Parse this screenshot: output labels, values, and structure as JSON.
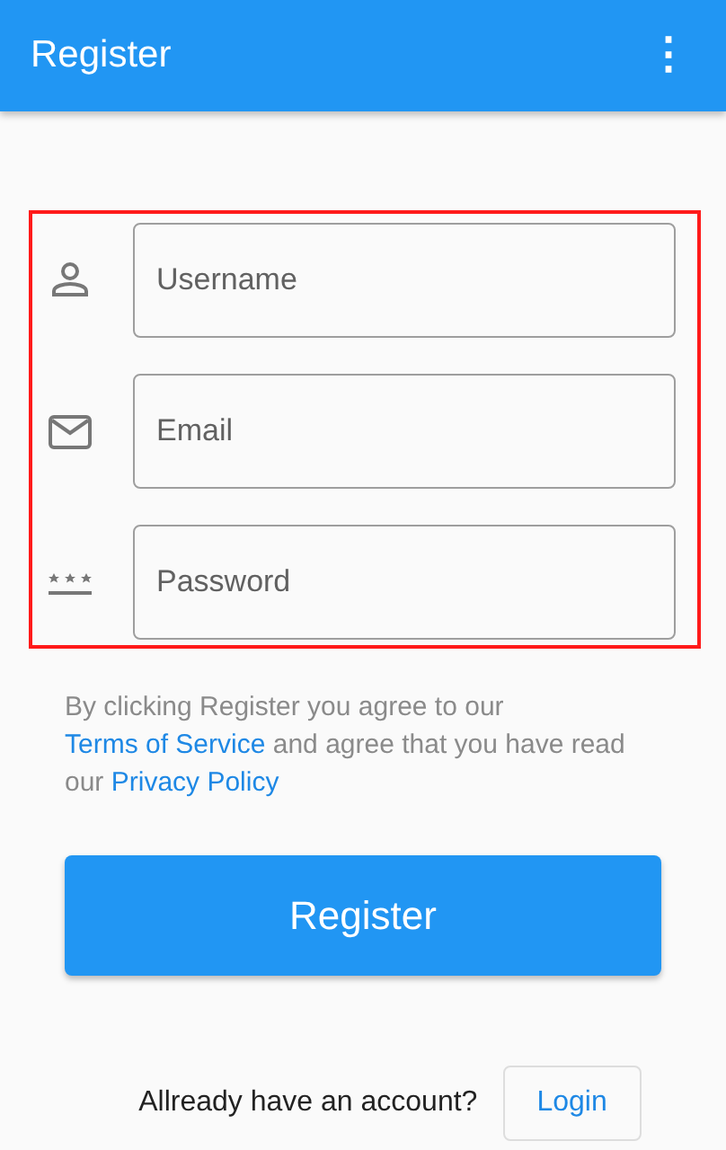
{
  "app_bar": {
    "title": "Register",
    "menu_icon": "⋮"
  },
  "fields": [
    {
      "kind": "user",
      "placeholder": "Username"
    },
    {
      "kind": "email",
      "placeholder": "Email"
    },
    {
      "kind": "password",
      "placeholder": "Password"
    }
  ],
  "terms": [
    {
      "text": "By clicking Register you agree to our ",
      "link": false
    },
    {
      "text": "Terms of Service",
      "link": true
    },
    {
      "text": " and agree that you have read our ",
      "link": false
    },
    {
      "text": "Privacy Policy",
      "link": true
    }
  ],
  "register_button": "Register",
  "footer": {
    "text": "Allready have an account?",
    "button": "Login"
  }
}
